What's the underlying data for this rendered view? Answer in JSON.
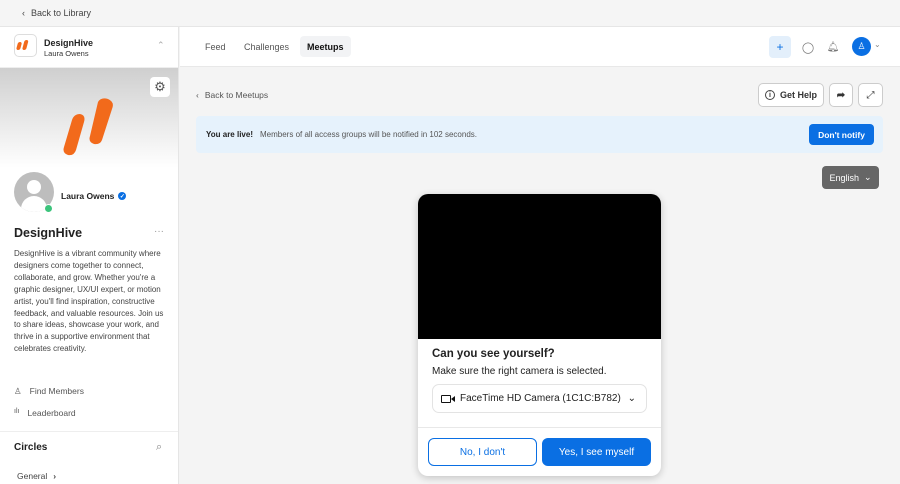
{
  "topbar": {
    "back_label": "Back to Library"
  },
  "sidebar": {
    "app_name": "DesignHive",
    "app_user": "Laura Owens",
    "user_name": "Laura Owens",
    "community_title": "DesignHive",
    "description": "DesignHive is a vibrant community where designers come together to connect, collaborate, and grow. Whether you're a graphic designer, UX/UI expert, or motion artist, you'll find inspiration, constructive feedback, and valuable resources. Join us to share ideas, showcase your work, and thrive in a supportive environment that celebrates creativity.",
    "nav": [
      {
        "label": "Find Members"
      },
      {
        "label": "Leaderboard"
      }
    ],
    "circles_title": "Circles",
    "circles": [
      {
        "label": "General"
      }
    ]
  },
  "header": {
    "tabs": [
      {
        "label": "Feed"
      },
      {
        "label": "Challenges"
      },
      {
        "label": "Meetups",
        "active": true
      }
    ]
  },
  "main": {
    "back_label": "Back to Meetups",
    "get_help": "Get Help",
    "alert": {
      "title": "You are live!",
      "message": "Members of all access groups will be notified in 102 seconds.",
      "button": "Don't notify"
    },
    "language": "English",
    "modal": {
      "title": "Can you see yourself?",
      "subtitle": "Make sure the right camera is selected.",
      "camera": "FaceTime HD Camera (1C1C:B782)",
      "no": "No, I don't",
      "yes": "Yes, I see myself"
    }
  },
  "colors": {
    "brand": "#f26a1b",
    "primary": "#0a6fe3",
    "online": "#3cc47c"
  }
}
